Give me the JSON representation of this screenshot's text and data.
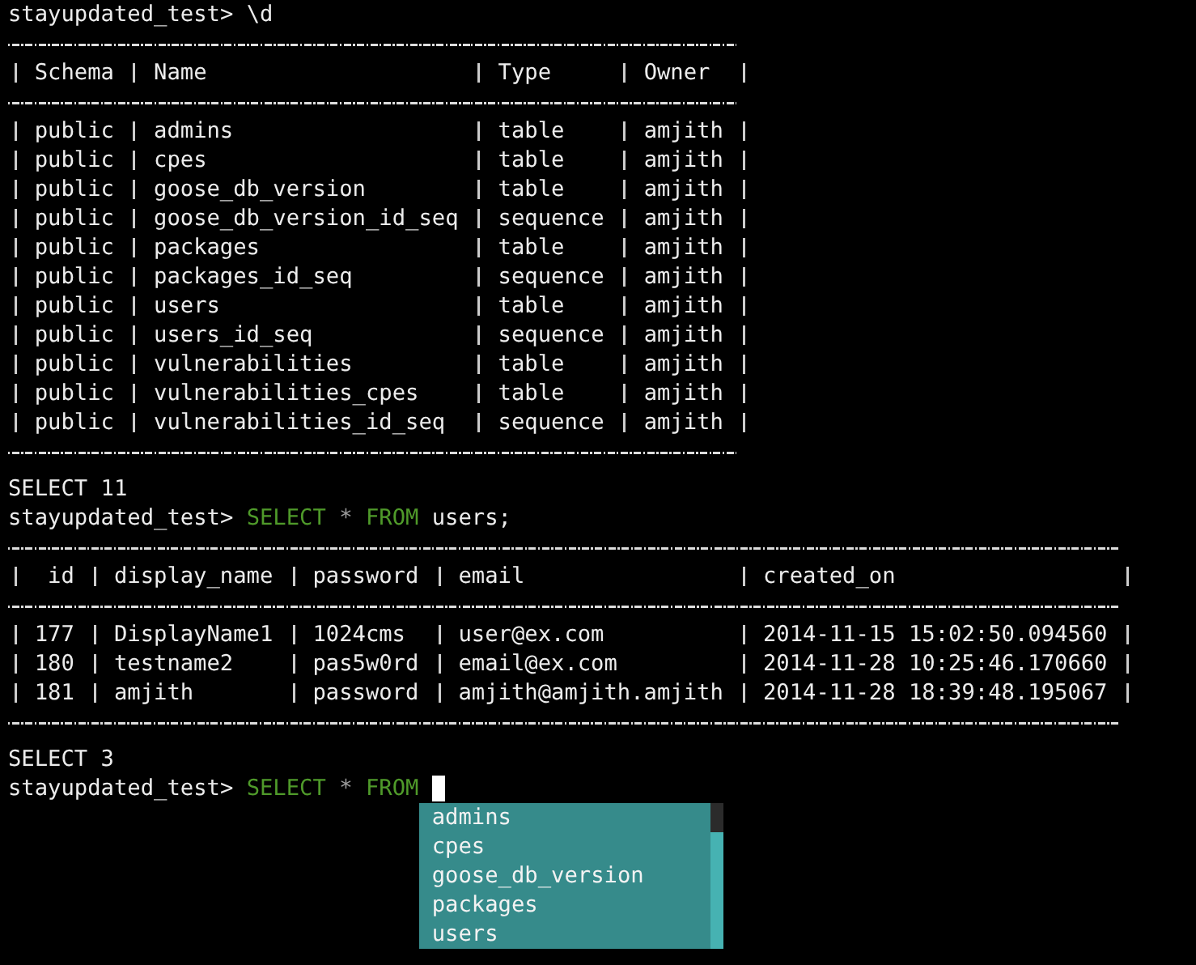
{
  "terminal": {
    "lines": [
      {
        "kind": "prompt",
        "prompt": "stayupdated_test>",
        "tokens": [
          {
            "kind": "plain",
            "text": "\\d"
          }
        ]
      },
      {
        "kind": "table",
        "columns": [
          {
            "label": "Schema"
          },
          {
            "label": "Name"
          },
          {
            "label": "Type"
          },
          {
            "label": "Owner"
          }
        ],
        "rows": [
          [
            "public",
            "admins",
            "table",
            "amjith"
          ],
          [
            "public",
            "cpes",
            "table",
            "amjith"
          ],
          [
            "public",
            "goose_db_version",
            "table",
            "amjith"
          ],
          [
            "public",
            "goose_db_version_id_seq",
            "sequence",
            "amjith"
          ],
          [
            "public",
            "packages",
            "table",
            "amjith"
          ],
          [
            "public",
            "packages_id_seq",
            "sequence",
            "amjith"
          ],
          [
            "public",
            "users",
            "table",
            "amjith"
          ],
          [
            "public",
            "users_id_seq",
            "sequence",
            "amjith"
          ],
          [
            "public",
            "vulnerabilities",
            "table",
            "amjith"
          ],
          [
            "public",
            "vulnerabilities_cpes",
            "table",
            "amjith"
          ],
          [
            "public",
            "vulnerabilities_id_seq",
            "sequence",
            "amjith"
          ]
        ]
      },
      {
        "kind": "status",
        "text": "SELECT 11"
      },
      {
        "kind": "prompt",
        "prompt": "stayupdated_test>",
        "tokens": [
          {
            "kind": "keyword",
            "text": "SELECT"
          },
          {
            "kind": "operator",
            "text": "*"
          },
          {
            "kind": "keyword",
            "text": "FROM"
          },
          {
            "kind": "plain",
            "text": "users;"
          }
        ]
      },
      {
        "kind": "table",
        "columns": [
          {
            "label": "id"
          },
          {
            "label": "display_name"
          },
          {
            "label": "password"
          },
          {
            "label": "email"
          },
          {
            "label": "created_on"
          }
        ],
        "rows": [
          [
            "177",
            "DisplayName1",
            "1024cms",
            "user@ex.com",
            "2014-11-15 15:02:50.094560"
          ],
          [
            "180",
            "testname2",
            "pas5w0rd",
            "email@ex.com",
            "2014-11-28 10:25:46.170660"
          ],
          [
            "181",
            "amjith",
            "password",
            "amjith@amjith.amjith",
            "2014-11-28 18:39:48.195067"
          ]
        ]
      },
      {
        "kind": "status",
        "text": "SELECT 3"
      },
      {
        "kind": "prompt",
        "prompt": "stayupdated_test>",
        "tokens": [
          {
            "kind": "keyword",
            "text": "SELECT"
          },
          {
            "kind": "operator",
            "text": "*"
          },
          {
            "kind": "keyword",
            "text": "FROM"
          }
        ],
        "cursor": true,
        "completions": [
          "admins",
          "cpes",
          "goose_db_version",
          "packages",
          "users"
        ]
      }
    ]
  }
}
